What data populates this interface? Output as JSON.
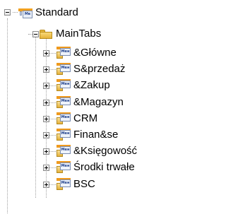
{
  "tree": {
    "root": {
      "label": "Standard",
      "icon": "menu-icon",
      "icon_text": "Ме",
      "expanded": true
    },
    "folder": {
      "label": "MainTabs",
      "icon": "folder-icon",
      "expanded": true
    },
    "item_icon_text": "Мен",
    "items": [
      {
        "label": "&Główne"
      },
      {
        "label": "S&przedaż"
      },
      {
        "label": "&Zakup"
      },
      {
        "label": "&Magazyn"
      },
      {
        "label": "CRM"
      },
      {
        "label": "Finan&se"
      },
      {
        "label": "&Księgowość"
      },
      {
        "label": "Środki trwałe"
      },
      {
        "label": "BSC"
      }
    ],
    "colors": {
      "accent_orange": "#ef9a1e",
      "folder_yellow": "#e6b43a",
      "connector": "#a0a0a0"
    }
  }
}
